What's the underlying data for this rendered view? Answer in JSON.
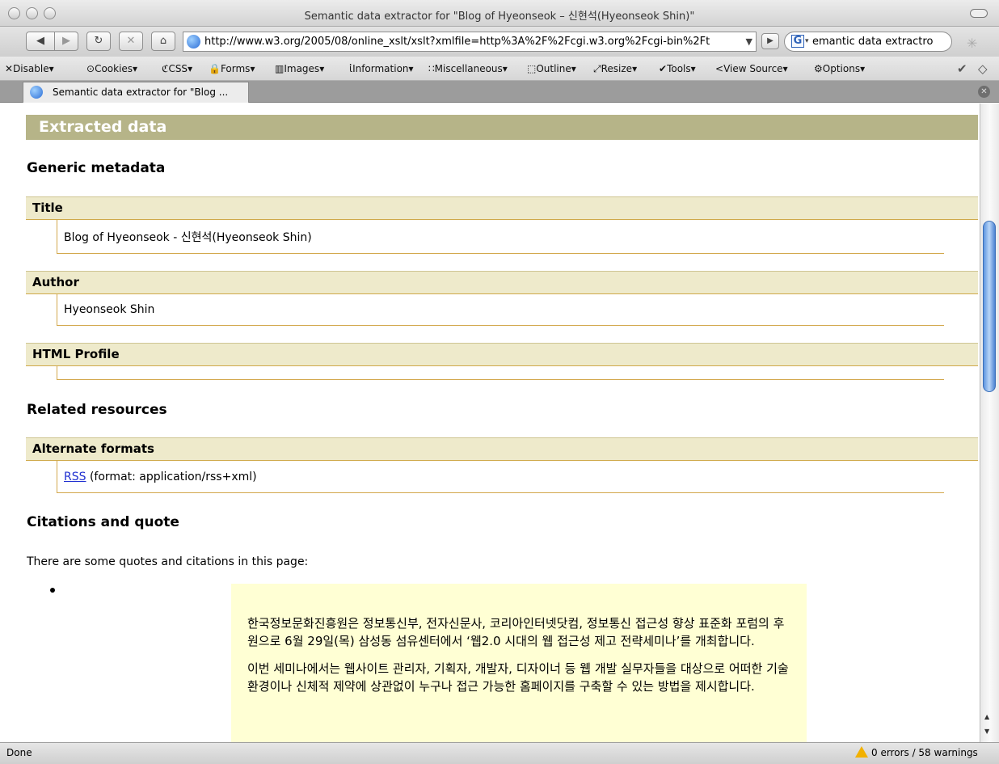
{
  "window": {
    "title": "Semantic data extractor for \"Blog of Hyeonseok – 신현석(Hyeonseok Shin)\""
  },
  "nav": {
    "back_icon": "◀",
    "forward_icon": "▶",
    "reload_icon": "↻",
    "stop_icon": "✕",
    "home_icon": "⌂",
    "url": "http://www.w3.org/2005/08/online_xslt/xslt?xmlfile=http%3A%2F%2Fcgi.w3.org%2Fcgi-bin%2Ft",
    "url_dropdown": "▼",
    "go_icon": "▶",
    "search_engine": "G",
    "search_value": "emantic data extractro"
  },
  "devtoolbar": {
    "items": [
      "Disable",
      "Cookies",
      "CSS",
      "Forms",
      "Images",
      "Information",
      "Miscellaneous",
      "Outline",
      "Resize",
      "Tools",
      "View Source",
      "Options"
    ],
    "icons": [
      "✕",
      "⊙",
      "ℭ",
      "🔒",
      "▥",
      "ἰ",
      "∷",
      "⬚",
      "⤢",
      "✔",
      "<",
      "⚙"
    ]
  },
  "tabs": [
    {
      "label": "Semantic data extractor for \"Blog ..."
    }
  ],
  "content": {
    "banner": "Extracted data",
    "generic_metadata": "Generic metadata",
    "title_label": "Title",
    "title_value": "Blog of Hyeonseok - 신현석(Hyeonseok Shin)",
    "author_label": "Author",
    "author_value": "Hyeonseok Shin",
    "html_profile_label": "HTML Profile",
    "related_resources": "Related resources",
    "alternate_formats_label": "Alternate formats",
    "rss_link": "RSS",
    "rss_format": " (format: application/rss+xml)",
    "citations_heading": "Citations and quote",
    "citations_intro": "There are some quotes and citations in this page:",
    "quote_p1": "한국정보문화진흥원은 정보통신부, 전자신문사, 코리아인터넷닷컴, 정보통신 접근성 향상 표준화 포럼의 후원으로 6월 29일(목) 삼성동 섬유센터에서 ‘웹2.0 시대의 웹 접근성 제고 전략세미나’를 개최합니다.",
    "quote_p2": "이번 세미나에서는 웹사이트 관리자, 기획자, 개발자, 디자이너 등 웹 개발 실무자들을 대상으로 어떠한 기술 환경이나 신체적 제약에 상관없이 누구나 접근 가능한 홈페이지를 구축할 수 있는 방법을 제시합니다."
  },
  "status": {
    "left": "Done",
    "right": "0 errors / 58 warnings"
  }
}
